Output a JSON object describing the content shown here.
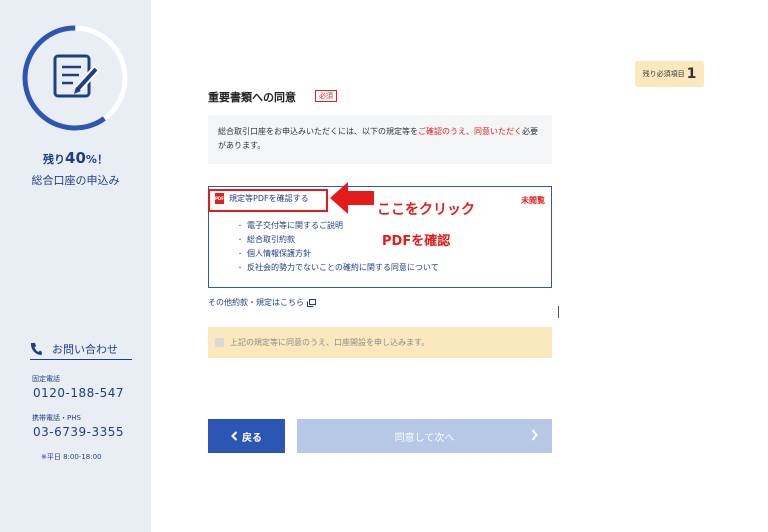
{
  "sidebar": {
    "progress_prefix": "残り",
    "progress_value": "40",
    "progress_suffix": "%！",
    "progress_fraction_remaining": 0.4,
    "progress_subtitle": "総合口座の申込み",
    "contact_label": "お問い合わせ",
    "landline_label": "固定電話",
    "landline_number": "0120-188-547",
    "mobile_label": "携帯電話・PHS",
    "mobile_number": "03-6739-3355",
    "hours": "※平日 8:00-18:00"
  },
  "remaining_badge": {
    "label": "残り必須項目",
    "count": "1"
  },
  "section": {
    "title": "重要書類への同意",
    "required_tag": "必須"
  },
  "notice": {
    "text_before": "総合取引口座をお申込みいただくには、以下の規定等を",
    "text_red": "ご確認のうえ、同意いただく",
    "text_after": "必要があります。"
  },
  "documents": {
    "pdf_link_label": "規定等PDFを確認する",
    "pdf_icon_text": "PDF",
    "status": "未閲覧",
    "items": [
      "電子交付等に関するご説明",
      "総合取引約款",
      "個人情報保護方針",
      "反社会的勢力でないことの確約に関する同意について"
    ]
  },
  "annotations": {
    "click_here": "ここをクリック",
    "check_pdf": "PDFを確認"
  },
  "other_link": "その他約款・規定はこちら",
  "agreement": {
    "text": "上記の規定等に同意のうえ、口座開設を申し込みます。"
  },
  "buttons": {
    "back": "戻る",
    "next": "同意して次へ"
  },
  "colors": {
    "brand": "#1e3f86",
    "accent_red": "#e41b1b",
    "sidebar_bg": "#e9eef5",
    "notice_yellow": "#fbe9bd",
    "button_blue": "#2c56b4",
    "button_disabled": "#b6c8e6"
  }
}
